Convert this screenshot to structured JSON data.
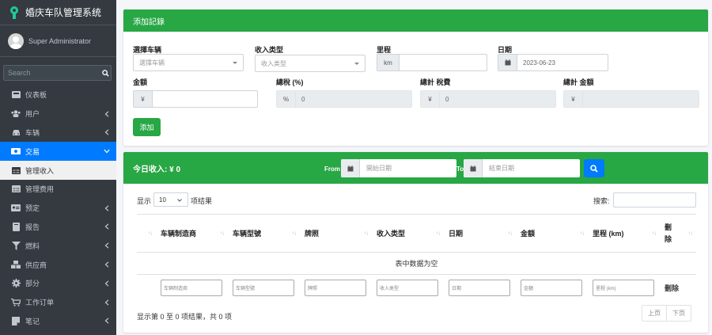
{
  "app": {
    "title": "婚庆车队管理系统",
    "user": "Super Administrator",
    "search_placeholder": "Search"
  },
  "sidebar": {
    "items": [
      {
        "label": "仪表板",
        "icon": "dashboard-icon",
        "chevron": false,
        "state": ""
      },
      {
        "label": "用户",
        "icon": "users-icon",
        "chevron": true,
        "state": ""
      },
      {
        "label": "车辆",
        "icon": "car-icon",
        "chevron": true,
        "state": ""
      },
      {
        "label": "交易",
        "icon": "money-icon",
        "chevron": true,
        "state": "active"
      },
      {
        "label": "管理收入",
        "icon": "table-icon",
        "chevron": false,
        "state": "sub-active"
      },
      {
        "label": "管理费用",
        "icon": "table-icon",
        "chevron": false,
        "state": ""
      },
      {
        "label": "预定",
        "icon": "id-card-icon",
        "chevron": true,
        "state": ""
      },
      {
        "label": "报告",
        "icon": "book-icon",
        "chevron": true,
        "state": ""
      },
      {
        "label": "燃料",
        "icon": "filter-icon",
        "chevron": true,
        "state": ""
      },
      {
        "label": "供应商",
        "icon": "cubes-icon",
        "chevron": true,
        "state": ""
      },
      {
        "label": "部分",
        "icon": "gear-icon",
        "chevron": true,
        "state": ""
      },
      {
        "label": "工作订单",
        "icon": "cart-icon",
        "chevron": true,
        "state": ""
      },
      {
        "label": "笔记",
        "icon": "note-icon",
        "chevron": true,
        "state": ""
      }
    ]
  },
  "add_form": {
    "title": "添加記錄",
    "vehicle_label": "選擇车辆",
    "vehicle_placeholder": "選擇车辆",
    "income_type_label": "收入类型",
    "income_type_placeholder": "收入类型",
    "mileage_label": "里程",
    "mileage_unit": "km",
    "date_label": "日期",
    "date_value": "2023-06-23",
    "amount_label": "金額",
    "amount_prefix": "¥",
    "tax_label": "總稅 (%)",
    "tax_prefix": "%",
    "tax_value": "0",
    "total_tax_label": "總計 稅費",
    "total_tax_prefix": "¥",
    "total_tax_value": "0",
    "total_amount_label": "總計 金額",
    "total_amount_prefix": "¥",
    "add_button": "添加"
  },
  "income_list": {
    "title": "今日收入: ¥ 0",
    "from_label": "From",
    "to_label": "To",
    "start_placeholder": "開始日期",
    "end_placeholder": "結束日期",
    "show_label": "显示",
    "page_length": "10",
    "entries_label": "项结果",
    "search_label": "搜索:",
    "columns": [
      "",
      "车辆制造商",
      "车辆型號",
      "牌照",
      "收入类型",
      "日期",
      "金額",
      "里程 (km)",
      "刪除"
    ],
    "empty_text": "表中数据为空",
    "filters": [
      "车辆制造商",
      "车辆型號",
      "牌照",
      "收入类型",
      "日期",
      "金額",
      "里程 (km)"
    ],
    "filter_last": "刪除",
    "info": "显示第 0 至 0 项结果，共 0 项",
    "prev": "上页",
    "next": "下页"
  }
}
